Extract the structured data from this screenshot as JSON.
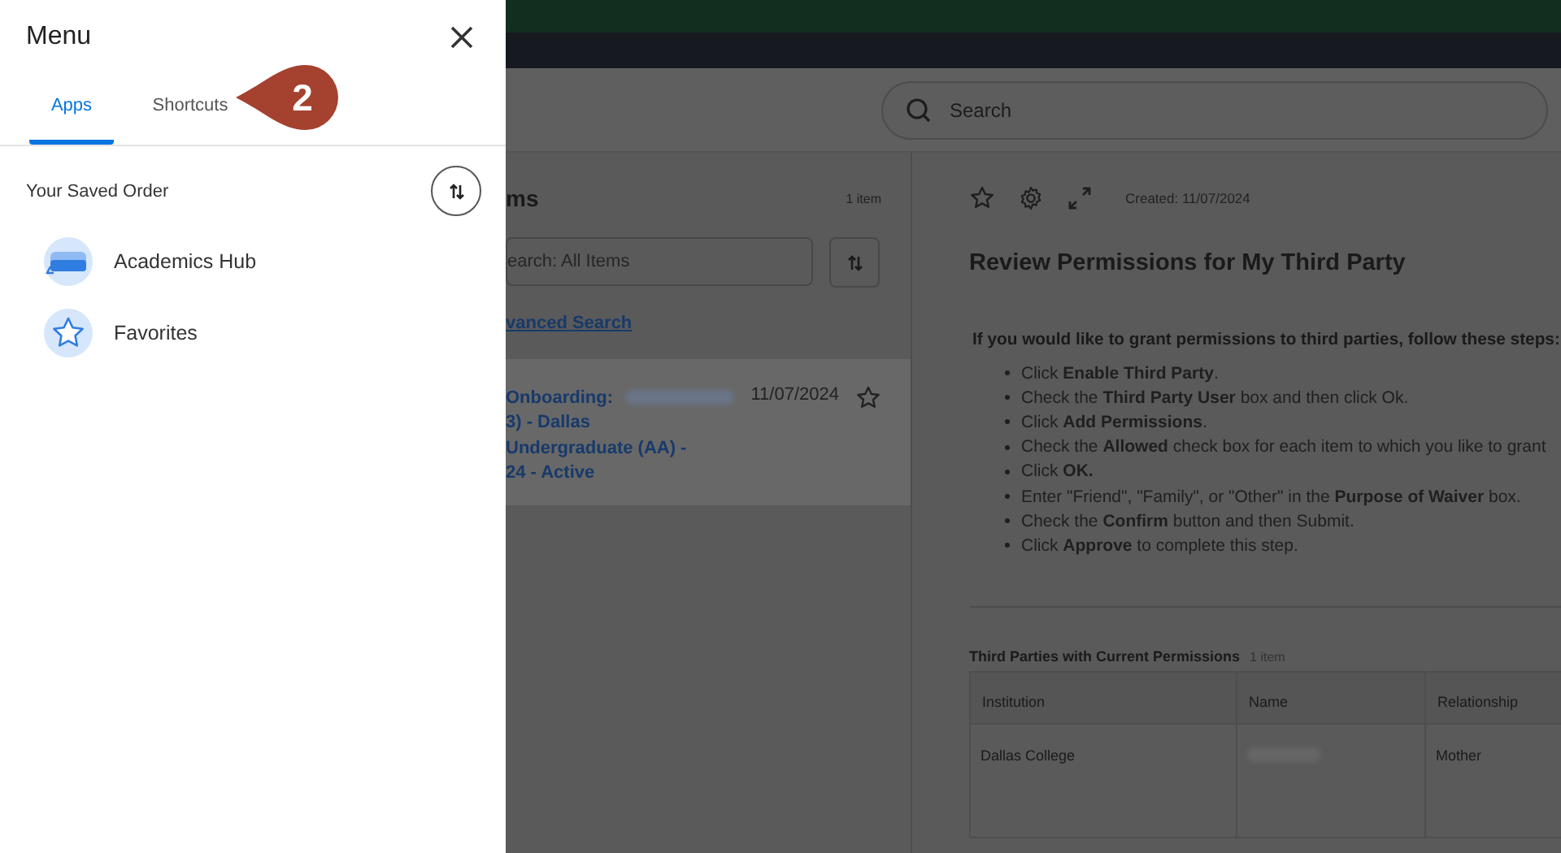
{
  "menu": {
    "title": "Menu",
    "tabs": [
      {
        "label": "Apps",
        "selected": true
      },
      {
        "label": "Shortcuts",
        "selected": false
      }
    ],
    "section_label": "Your Saved Order",
    "items": [
      {
        "label": "Academics Hub",
        "kind": "hub"
      },
      {
        "label": "Favorites",
        "kind": "star"
      }
    ]
  },
  "callout": {
    "number": "2"
  },
  "header": {
    "search": {
      "placeholder": "Search"
    }
  },
  "inbox": {
    "title": "ms",
    "count": "1 item",
    "search": {
      "placeholder": "earch: All Items"
    },
    "link": "vanced Search",
    "items": [
      {
        "lines": [
          "Onboarding:",
          "3) - Dallas",
          "Undergraduate (AA) -",
          "24 - Active"
        ],
        "redacted": true,
        "date": "11/07/2024",
        "selected": true
      }
    ]
  },
  "detail": {
    "created": "Created: 11/07/2024",
    "title": "Review Permissions for My Third Party",
    "intro": "If you would like to grant permissions to third parties, follow these steps:",
    "steps": [
      "Click **Enable Third Party**.",
      "Check the **Third Party User** box and then click Ok.",
      "Click **Add Permissions**.",
      "Check the **Allowed** check box for each item to which you like to grant",
      "Click **OK.**",
      "Enter \"Friend\", \"Family\", or \"Other\" in the **Purpose of Waiver** box.",
      "Check the **Confirm** button and then Submit.",
      "Click **Approve** to complete this step."
    ],
    "table": {
      "title": "Third Parties with Current Permissions",
      "count": "1 item",
      "columns": [
        "Institution",
        "Name",
        "Relationship"
      ],
      "rows": [
        {
          "institution": "Dallas College",
          "name_redacted": true,
          "relationship": "Mother"
        }
      ]
    }
  }
}
